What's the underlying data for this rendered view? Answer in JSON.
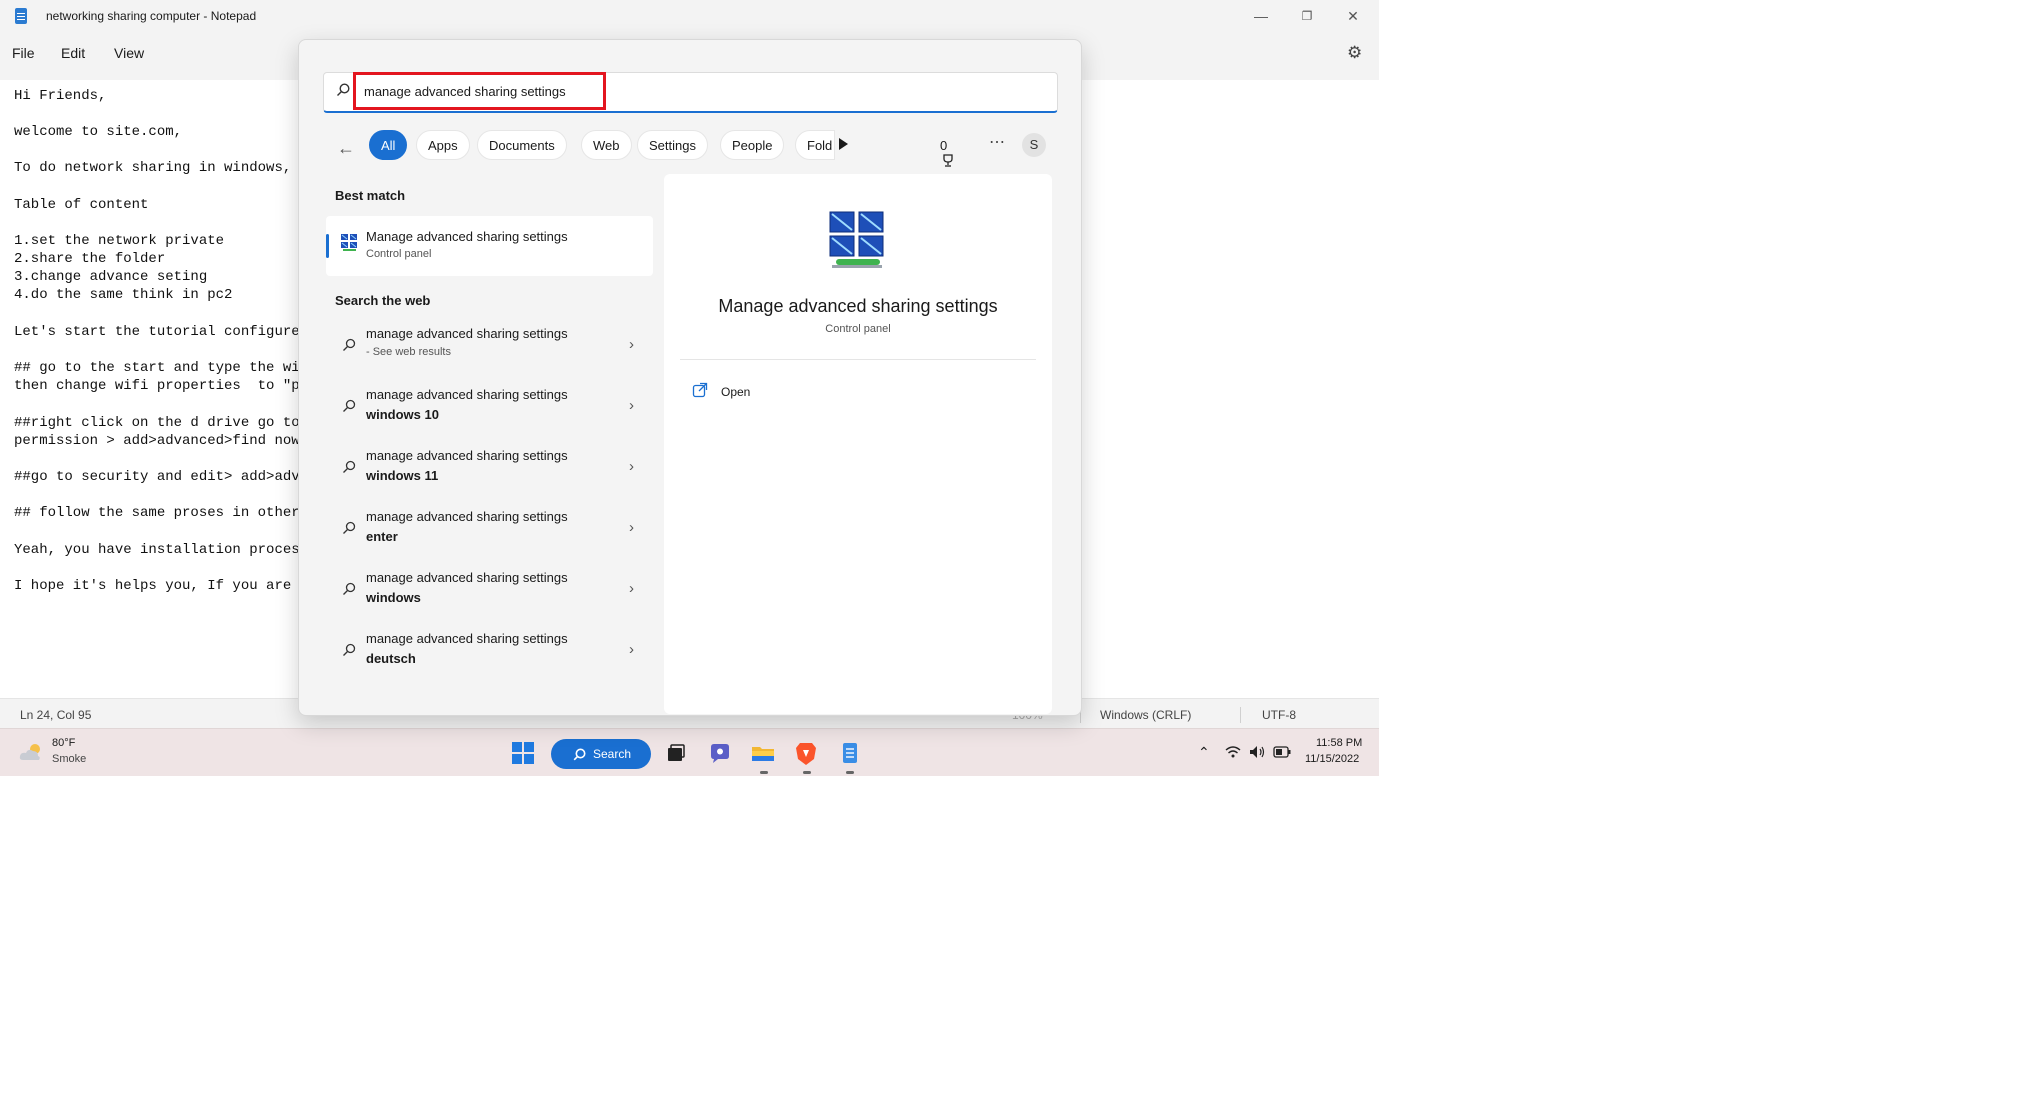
{
  "notepad": {
    "title": "networking sharing computer - Notepad",
    "menu": [
      "File",
      "Edit",
      "View"
    ],
    "lines": [
      "Hi Friends,",
      "",
      "welcome to site.com,",
      "",
      "To do network sharing in windows, o",
      "",
      "Table of content",
      "",
      "1.set the network private",
      "2.share the folder",
      "3.change advance seting",
      "4.do the same think in pc2",
      "",
      "Let's start the tutorial configure",
      "",
      "## go to the start and type the wif",
      "then change wifi properties  to \"pr",
      "",
      "##right click on the d drive go to",
      "permission > add>advanced>find now>",
      "",
      "##go to security and edit> add>adva",
      "",
      "## follow the same proses in other",
      "",
      "Yeah, you have installation process",
      "",
      "I hope it's helps you, If you are f"
    ],
    "status": {
      "position": "Ln 24, Col 95",
      "zoom": "100%",
      "line_ending": "Windows (CRLF)",
      "encoding": "UTF-8"
    }
  },
  "search": {
    "query": "manage advanced sharing settings",
    "filters": [
      "All",
      "Apps",
      "Documents",
      "Web",
      "Settings",
      "People",
      "Fold"
    ],
    "active_filter": "All",
    "points": "0",
    "avatar_initial": "S",
    "best_match_heading": "Best match",
    "best_match": {
      "title": "Manage advanced sharing settings",
      "subtitle": "Control panel"
    },
    "web_heading": "Search the web",
    "web_results": [
      {
        "text": "manage advanced sharing settings",
        "suffix": "- See web results"
      },
      {
        "text": "manage advanced sharing settings",
        "suffix": "windows 10"
      },
      {
        "text": "manage advanced sharing settings",
        "suffix": "windows 11"
      },
      {
        "text": "manage advanced sharing settings",
        "suffix": "enter"
      },
      {
        "text": "manage advanced sharing settings",
        "suffix": "windows"
      },
      {
        "text": "manage advanced sharing settings",
        "suffix": "deutsch"
      }
    ],
    "preview": {
      "title": "Manage advanced sharing settings",
      "subtitle": "Control panel",
      "action_open": "Open"
    }
  },
  "taskbar": {
    "weather": {
      "temp": "80°F",
      "desc": "Smoke"
    },
    "search_label": "Search",
    "time": "11:58 PM",
    "date": "11/15/2022"
  },
  "colors": {
    "accent": "#1a6fd1",
    "highlight": "#e3151f"
  }
}
